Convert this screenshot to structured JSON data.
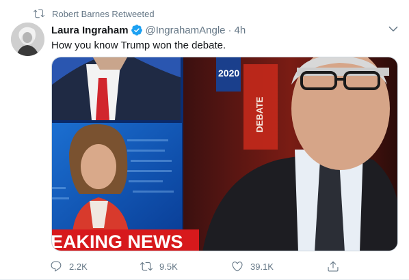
{
  "retweet_context": {
    "text": "Robert Barnes Retweeted",
    "icon": "retweet-icon"
  },
  "author": {
    "display_name": "Laura Ingraham",
    "verified": true,
    "handle": "@IngrahamAngle",
    "separator": "·",
    "time": "4h"
  },
  "tweet": {
    "text": "How you know Trump won the debate."
  },
  "media": {
    "caption": "EAKING NEWS",
    "studio_sign": "DEBATE",
    "year_sign": "2020"
  },
  "actions": {
    "reply_count": "2.2K",
    "retweet_count": "9.5K",
    "like_count": "39.1K"
  },
  "colors": {
    "secondary_text": "#657786",
    "verified_blue": "#1da1f2",
    "breaking_red": "#d7191c"
  }
}
